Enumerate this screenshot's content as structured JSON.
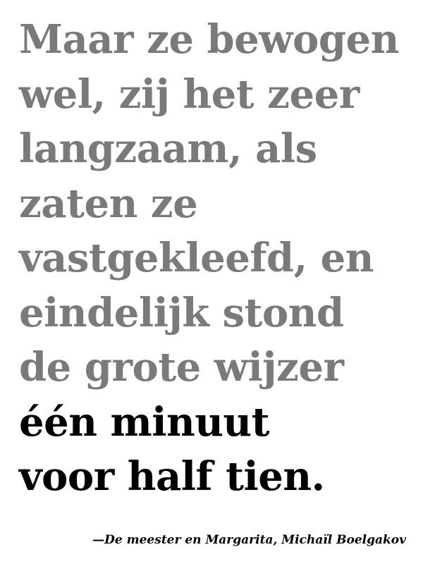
{
  "quote": {
    "lines": [
      "Maar ze bewogen",
      "wel, zij het zeer",
      "langzaam, als",
      "zaten ze",
      "vastgekleefd, en",
      "eindelijk stond",
      "de grote wijzer"
    ],
    "highlight_lines": [
      "één minuut",
      "voor half tien."
    ]
  },
  "attribution": "—De meester en Margarita, Michaïl Boelgakov",
  "colors": {
    "body_text": "#7a7a7a",
    "highlight_text": "#000000",
    "background": "#ffffff"
  }
}
